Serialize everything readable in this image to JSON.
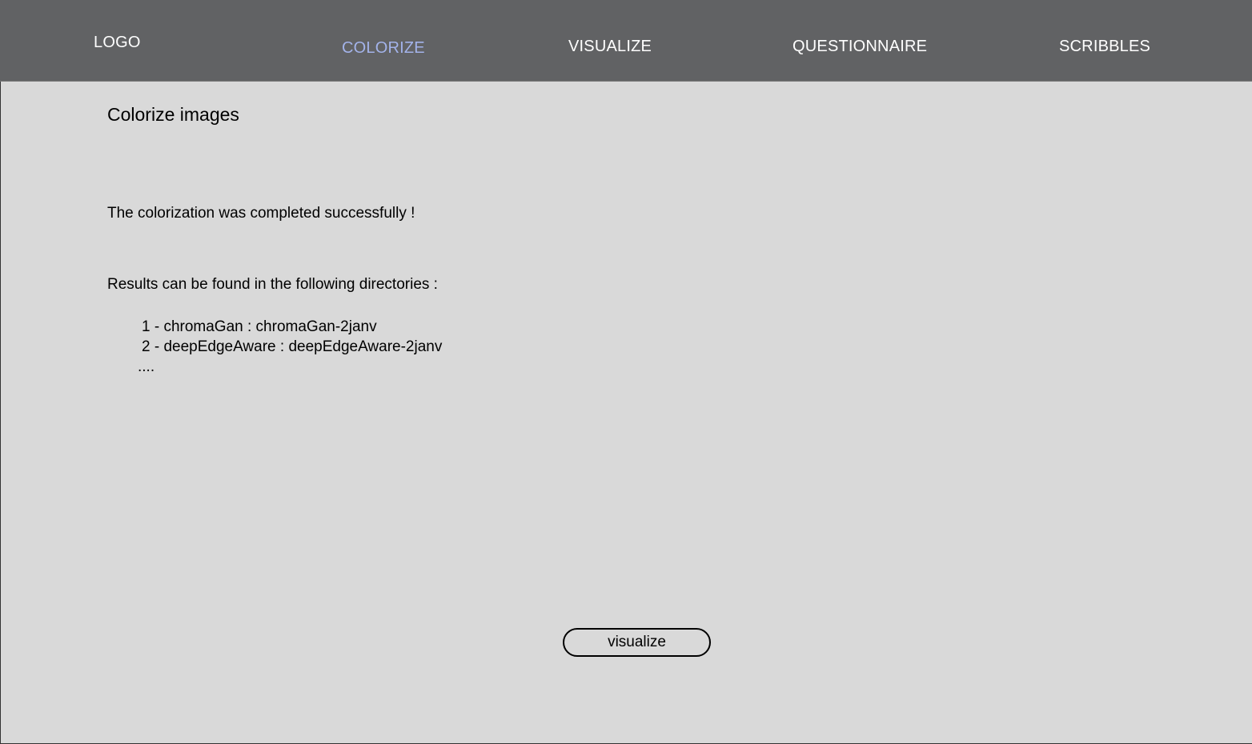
{
  "header": {
    "logo": "LOGO",
    "nav": [
      {
        "label": "COLORIZE",
        "active": true
      },
      {
        "label": "VISUALIZE",
        "active": false
      },
      {
        "label": "QUESTIONNAIRE",
        "active": false
      },
      {
        "label": "SCRIBBLES",
        "active": false
      }
    ]
  },
  "main": {
    "title": "Colorize images",
    "success_message": "The colorization was completed successfully !",
    "results_intro": "Results can be found in the following directories :",
    "directories": [
      "1 - chromaGan : chromaGan-2janv",
      "2 - deepEdgeAware : deepEdgeAware-2janv",
      "...."
    ],
    "visualize_button": "visualize"
  },
  "colors": {
    "header_bg": "#616264",
    "page_bg": "#d9d9d9",
    "nav_text": "#ffffff",
    "nav_active": "#a3b3ea",
    "text": "#000000"
  }
}
